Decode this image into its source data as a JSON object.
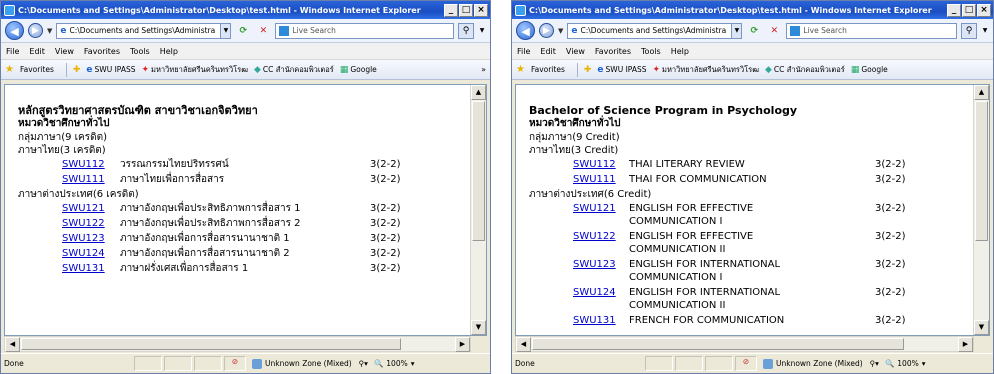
{
  "windows": [
    {
      "title": "C:\\Documents and Settings\\Administrator\\Desktop\\test.html - Windows Internet Explorer",
      "address": "C:\\Documents and Settings\\Administra",
      "search_placeholder": "Live Search",
      "menu": [
        "File",
        "Edit",
        "View",
        "Favorites",
        "Tools",
        "Help"
      ],
      "favorites_label": "Favorites",
      "favorites_links": [
        "SWU IPASS",
        "มหาวิทยาลัยศรีนครินทรวิโรฒ",
        "CC สำนักคอมพิวเตอร์",
        "Google"
      ],
      "heading1": "หลักสูตรวิทยาศาสตรบัณฑิต สาขาวิชาเอกจิตวิทยา",
      "heading2": "หมวดวิชาศึกษาทั่วไป",
      "groups": [
        "กลุ่มภาษา(9 เครดิต)",
        "ภาษาไทย(3 เครดิต)",
        "ภาษาต่างประเทศ(6 เครดิต)"
      ],
      "courses_thai": [
        {
          "code": "SWU112",
          "name": "วรรณกรรมไทยปริทรรศน์",
          "credit": "3(2-2)"
        },
        {
          "code": "SWU111",
          "name": "ภาษาไทยเพื่อการสื่อสาร",
          "credit": "3(2-2)"
        }
      ],
      "courses_foreign": [
        {
          "code": "SWU121",
          "name": "ภาษาอังกฤษเพื่อประสิทธิภาพการสื่อสาร 1",
          "credit": "3(2-2)"
        },
        {
          "code": "SWU122",
          "name": "ภาษาอังกฤษเพื่อประสิทธิภาพการสื่อสาร 2",
          "credit": "3(2-2)"
        },
        {
          "code": "SWU123",
          "name": "ภาษาอังกฤษเพื่อการสื่อสารนานาชาติ 1",
          "credit": "3(2-2)"
        },
        {
          "code": "SWU124",
          "name": "ภาษาอังกฤษเพื่อการสื่อสารนานาชาติ 2",
          "credit": "3(2-2)"
        },
        {
          "code": "SWU131",
          "name": "ภาษาฝรั่งเศสเพื่อการสื่อสาร 1",
          "credit": "3(2-2)"
        }
      ],
      "status": {
        "done": "Done",
        "zone": "Unknown Zone (Mixed)",
        "zoom": "100%"
      }
    },
    {
      "title": "C:\\Documents and Settings\\Administrator\\Desktop\\test.html - Windows Internet Explorer",
      "address": "C:\\Documents and Settings\\Administra",
      "search_placeholder": "Live Search",
      "menu": [
        "File",
        "Edit",
        "View",
        "Favorites",
        "Tools",
        "Help"
      ],
      "favorites_label": "Favorites",
      "favorites_links": [
        "SWU IPASS",
        "มหาวิทยาลัยศรีนครินทรวิโรฒ",
        "CC สำนักคอมพิวเตอร์",
        "Google"
      ],
      "heading1": "Bachelor of Science Program in Psychology",
      "heading2": "หมวดวิชาศึกษาทั่วไป",
      "groups": [
        "กลุ่มภาษา(9 Credit)",
        "ภาษาไทย(3 Credit)",
        "ภาษาต่างประเทศ(6 Credit)"
      ],
      "courses_thai": [
        {
          "code": "SWU112",
          "name": "THAI LITERARY REVIEW",
          "credit": "3(2-2)"
        },
        {
          "code": "SWU111",
          "name": "THAI FOR COMMUNICATION",
          "credit": "3(2-2)"
        }
      ],
      "courses_foreign": [
        {
          "code": "SWU121",
          "name": "ENGLISH FOR EFFECTIVE COMMUNICATION I",
          "credit": "3(2-2)"
        },
        {
          "code": "SWU122",
          "name": "ENGLISH FOR EFFECTIVE COMMUNICATION II",
          "credit": "3(2-2)"
        },
        {
          "code": "SWU123",
          "name": "ENGLISH FOR INTERNATIONAL COMMUNICATION I",
          "credit": "3(2-2)"
        },
        {
          "code": "SWU124",
          "name": "ENGLISH FOR INTERNATIONAL COMMUNICATION II",
          "credit": "3(2-2)"
        },
        {
          "code": "SWU131",
          "name": "FRENCH FOR COMMUNICATION",
          "credit": "3(2-2)"
        }
      ],
      "status": {
        "done": "Done",
        "zone": "Unknown Zone (Mixed)",
        "zoom": "100%"
      }
    }
  ]
}
